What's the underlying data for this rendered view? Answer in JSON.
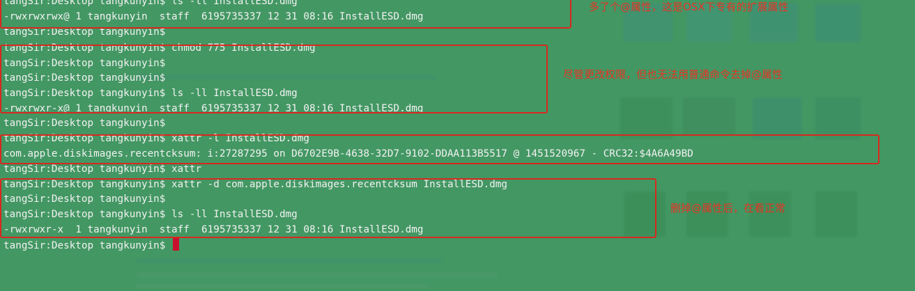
{
  "colors": {
    "terminal_bg": "#3e9660",
    "text": "#f2f2f2",
    "annotation": "#e53424",
    "cursor": "#c8102e"
  },
  "terminal": {
    "lines": [
      "tangSir:Desktop tangkunyin$ ls -ll InstallESD.dmg",
      "-rwxrwxrwx@ 1 tangkunyin  staff  6195735337 12 31 08:16 InstallESD.dmg",
      "tangSir:Desktop tangkunyin$",
      "tangSir:Desktop tangkunyin$ chmod 775 InstallESD.dmg",
      "tangSir:Desktop tangkunyin$",
      "tangSir:Desktop tangkunyin$",
      "tangSir:Desktop tangkunyin$ ls -ll InstallESD.dmg",
      "-rwxrwxr-x@ 1 tangkunyin  staff  6195735337 12 31 08:16 InstallESD.dmg",
      "tangSir:Desktop tangkunyin$",
      "tangSir:Desktop tangkunyin$ xattr -l InstallESD.dmg",
      "com.apple.diskimages.recentcksum: i:27287295 on D6702E9B-4638-32D7-9102-DDAA113B5517 @ 1451520967 - CRC32:$4A6A49BD",
      "tangSir:Desktop tangkunyin$ xattr",
      "tangSir:Desktop tangkunyin$ xattr -d com.apple.diskimages.recentcksum InstallESD.dmg",
      "tangSir:Desktop tangkunyin$",
      "tangSir:Desktop tangkunyin$ ls -ll InstallESD.dmg",
      "-rwxrwxr-x  1 tangkunyin  staff  6195735337 12 31 08:16 InstallESD.dmg",
      "tangSir:Desktop tangkunyin$"
    ]
  },
  "annotations": {
    "note1": "多了个@属性，这是OSX下专有的扩展属性",
    "note2": "尽管更改权限，但也无法用普通命令去掉@属性",
    "note3": "删掉@属性后，在看正常"
  }
}
